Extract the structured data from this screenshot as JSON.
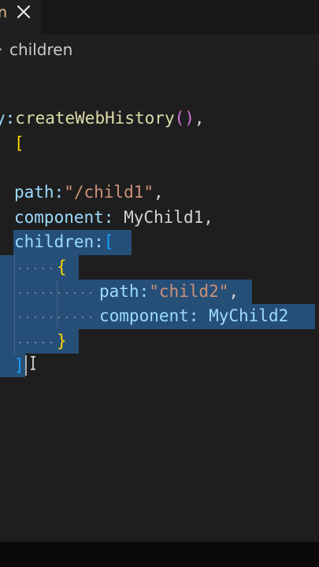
{
  "tab": {
    "fragment": "n",
    "close_glyph": "✕"
  },
  "breadcrumb": {
    "label": "children"
  },
  "code": {
    "l1_prefix": "y:",
    "l1_fn": "createWebHistory",
    "l1_parens": "()",
    "l1_comma": ",",
    "l2_bracket": "[",
    "l3_bracket": "{",
    "l4_key": "path:",
    "l4_value": "\"/child1\"",
    "l4_comma": ",",
    "l5_key": "component:",
    "l5_value": " MyChild1,",
    "l6_key": "children:",
    "l6_bracket": "[",
    "l7_brace": "{",
    "l8_key": "path:",
    "l8_value": "\"child2\"",
    "l8_comma": ",",
    "l9_key": "component:",
    "l9_value": " MyChild2",
    "l10_brace": "}",
    "l11_bracket": "]"
  },
  "colors": {
    "editor_bg": "#1e1e1e",
    "selection": "#264f78",
    "function": "#dcdcaa",
    "property": "#9cdcfe",
    "string": "#ce9178",
    "bracket_gold": "#ffd700",
    "bracket_orchid": "#da70d6",
    "bracket_blue": "#179fff"
  }
}
